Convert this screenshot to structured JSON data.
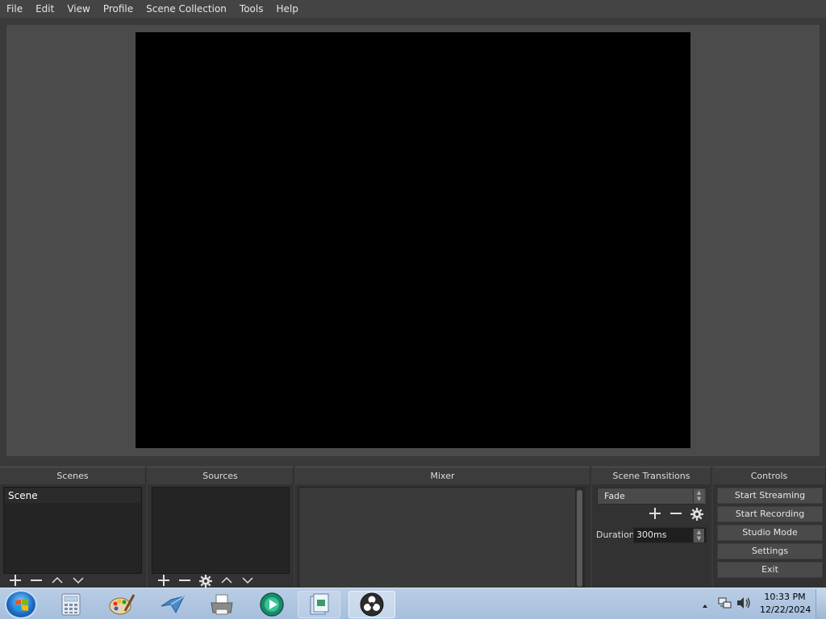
{
  "menu": {
    "items": [
      "File",
      "Edit",
      "View",
      "Profile",
      "Scene Collection",
      "Tools",
      "Help"
    ]
  },
  "docks": {
    "scenes": {
      "title": "Scenes",
      "items": [
        "Scene"
      ]
    },
    "sources": {
      "title": "Sources"
    },
    "mixer": {
      "title": "Mixer"
    },
    "transitions": {
      "title": "Scene Transitions",
      "selected": "Fade",
      "duration_label": "Duration",
      "duration_value": "300ms"
    },
    "controls": {
      "title": "Controls",
      "buttons": [
        "Start Streaming",
        "Start Recording",
        "Studio Mode",
        "Settings",
        "Exit"
      ]
    }
  },
  "taskbar": {
    "apps": [
      "calculator-icon",
      "paint-icon",
      "visual-studio-icon",
      "printer-icon",
      "media-player-icon",
      "file-explorer-icon",
      "obs-icon"
    ],
    "clock_time": "10:33 PM",
    "clock_date": "12/22/2024"
  },
  "colors": {
    "window_bg": "#3a3a3a",
    "preview_bg": "#4b4b4b",
    "canvas": "#000000",
    "taskbar": "#b9cde4"
  }
}
